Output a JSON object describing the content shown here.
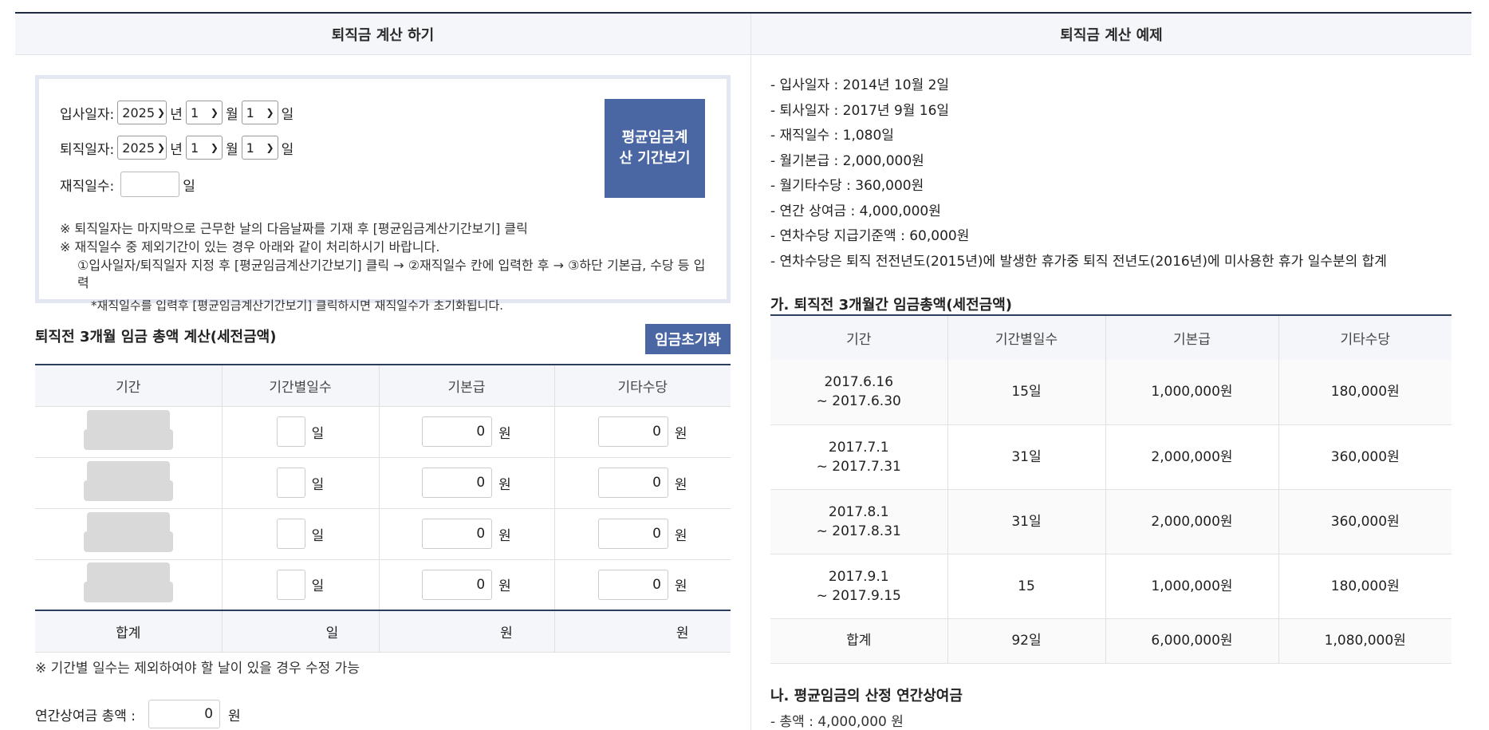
{
  "left_panel": {
    "title": "퇴직금 계산 하기",
    "join_date_label": "입사일자:",
    "leave_date_label": "퇴직일자:",
    "year_unit": "년",
    "month_unit": "월",
    "day_unit": "일",
    "join_year": "2025",
    "join_month": "1",
    "join_day": "1",
    "leave_year": "2025",
    "leave_month": "1",
    "leave_day": "1",
    "work_days_label": "재직일수:",
    "work_days_unit": "일",
    "avg_button": "평균임금계산 기간보기",
    "note1": "※ 퇴직일자는 마지막으로 근무한 날의 다음날짜를 기재 후 [평균임금계산기간보기] 클릭",
    "note2": "※ 재직일수 중 제외기간이 있는 경우 아래와 같이 처리하시기 바랍니다.",
    "note3": "①입사일자/퇴직일자 지정 후 [평균임금계산기간보기] 클릭 → ②재직일수 칸에 입력한 후 → ③하단 기본급, 수당 등 입력",
    "note4": "*재직일수를 입력후 [평균임금계산기간보기] 클릭하시면 재직일수가 초기화됩니다.",
    "section_title": "퇴직전 3개월 임금 총액 계산(세전금액)",
    "reset_button": "임금초기화",
    "headers": [
      "기간",
      "기간별일수",
      "기본급",
      "기타수당"
    ],
    "rows": [
      {
        "days_unit": "일",
        "base": "0",
        "base_unit": "원",
        "other": "0",
        "other_unit": "원"
      },
      {
        "days_unit": "일",
        "base": "0",
        "base_unit": "원",
        "other": "0",
        "other_unit": "원"
      },
      {
        "days_unit": "일",
        "base": "0",
        "base_unit": "원",
        "other": "0",
        "other_unit": "원"
      },
      {
        "days_unit": "일",
        "base": "0",
        "base_unit": "원",
        "other": "0",
        "other_unit": "원"
      }
    ],
    "sum_row": {
      "label": "합계",
      "days": "일",
      "base": "원",
      "other": "원"
    },
    "note5": "※ 기간별 일수는 제외하여야 할 날이 있을 경우 수정 가능",
    "bonus_label": "연간상여금 총액 :",
    "bonus_value": "0",
    "bonus_unit": "원"
  },
  "right_panel": {
    "title": "퇴직금 계산 예제",
    "info": [
      "- 입사일자 : 2014년 10월 2일",
      "- 퇴사일자 : 2017년 9월 16일",
      "- 재직일수 : 1,080일",
      "- 월기본급 : 2,000,000원",
      "- 월기타수당 : 360,000원",
      "- 연간 상여금 : 4,000,000원",
      "- 연차수당 지급기준액 : 60,000원",
      "- 연차수당은 퇴직 전전년도(2015년)에 발생한 휴가중 퇴직 전년도(2016년)에 미사용한 휴가 일수분의 합계"
    ],
    "section_a": "가. 퇴직전 3개월간 임금총액(세전금액)",
    "headers": [
      "기간",
      "기간별일수",
      "기본급",
      "기타수당"
    ],
    "rows": [
      {
        "period1": "2017.6.16",
        "period2": "~ 2017.6.30",
        "days": "15일",
        "base": "1,000,000원",
        "other": "180,000원"
      },
      {
        "period1": "2017.7.1",
        "period2": "~ 2017.7.31",
        "days": "31일",
        "base": "2,000,000원",
        "other": "360,000원"
      },
      {
        "period1": "2017.8.1",
        "period2": "~ 2017.8.31",
        "days": "31일",
        "base": "2,000,000원",
        "other": "360,000원"
      },
      {
        "period1": "2017.9.1",
        "period2": "~ 2017.9.15",
        "days": "15",
        "base": "1,000,000원",
        "other": "180,000원"
      }
    ],
    "sum_row": {
      "label": "합계",
      "days": "92일",
      "base": "6,000,000원",
      "other": "1,080,000원"
    },
    "section_b": "나. 평균임금의 산정 연간상여금",
    "total_line": "- 총액 : 4,000,000 원"
  }
}
